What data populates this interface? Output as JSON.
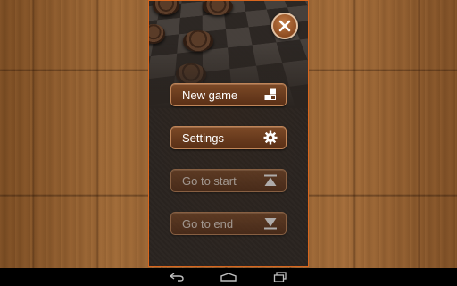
{
  "menu": {
    "items": [
      {
        "label": "New game",
        "icon": "new-game-icon",
        "enabled": true
      },
      {
        "label": "Settings",
        "icon": "gear-icon",
        "enabled": true
      },
      {
        "label": "Go to start",
        "icon": "go-to-start-icon",
        "enabled": false
      },
      {
        "label": "Go to end",
        "icon": "go-to-end-icon",
        "enabled": false
      }
    ]
  },
  "navbar": {
    "icons": [
      "back-icon",
      "home-icon",
      "recent-apps-icon"
    ]
  },
  "colors": {
    "panel_border": "#d9661e",
    "button_fill": "#6a3c1e",
    "wood": "#8c5a2c"
  }
}
